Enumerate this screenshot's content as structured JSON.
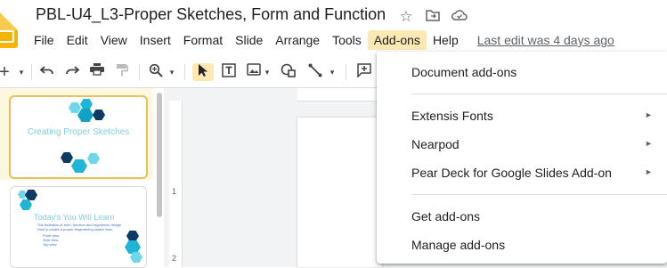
{
  "doc": {
    "title": "PBL-U4_L3-Proper Sketches, Form and Function",
    "last_edit": "Last edit was 4 days ago"
  },
  "menu": [
    {
      "label": "File"
    },
    {
      "label": "Edit"
    },
    {
      "label": "View"
    },
    {
      "label": "Insert"
    },
    {
      "label": "Format"
    },
    {
      "label": "Slide"
    },
    {
      "label": "Arrange"
    },
    {
      "label": "Tools"
    },
    {
      "label": "Add-ons",
      "active": true
    },
    {
      "label": "Help"
    }
  ],
  "addons_menu": {
    "document_addons": "Document add-ons",
    "extensis_fonts": "Extensis Fonts",
    "nearpod": "Nearpod",
    "pear_deck": "Pear Deck for Google Slides Add-on",
    "get_addons": "Get add-ons",
    "manage_addons": "Manage add-ons"
  },
  "slides": {
    "slide1_title": "Creating Proper Sketches",
    "slide2_title": "Today's You Will Learn",
    "slide2_line1": "The definition of form, function and ergonomic design",
    "slide2_line2": "How to create a proper engineering sketch from",
    "slide2_line3": "Front view",
    "slide2_line4": "Side view",
    "slide2_line5": "Top view"
  },
  "ruler": {
    "left_1": "1",
    "left_2": "2"
  },
  "colors": {
    "accent": "#fce8b2",
    "selected_border": "#e8c15c",
    "brand": "#f4b400",
    "hex_teal": "#1fb5d6",
    "hex_navy": "#0d3b66"
  }
}
